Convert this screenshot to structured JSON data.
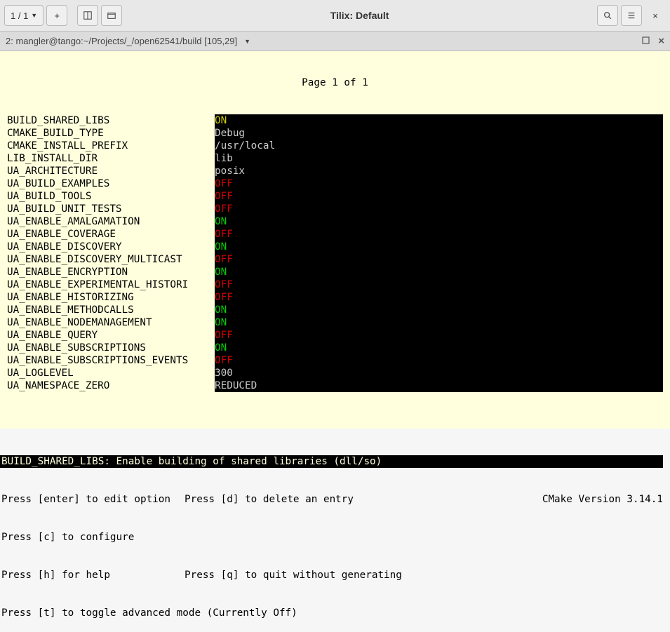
{
  "titlebar": {
    "counter": "1 / 1",
    "title": "Tilix: Default"
  },
  "tab": {
    "label": "2: mangler@tango:~/Projects/_/open62541/build [105,29]"
  },
  "page_header": "Page 1 of 1",
  "options": [
    {
      "key": "BUILD_SHARED_LIBS",
      "val": "ON",
      "cls": "yellow"
    },
    {
      "key": "CMAKE_BUILD_TYPE",
      "val": "Debug",
      "cls": ""
    },
    {
      "key": "CMAKE_INSTALL_PREFIX",
      "val": "/usr/local",
      "cls": ""
    },
    {
      "key": "LIB_INSTALL_DIR",
      "val": "lib",
      "cls": ""
    },
    {
      "key": "UA_ARCHITECTURE",
      "val": "posix",
      "cls": ""
    },
    {
      "key": "UA_BUILD_EXAMPLES",
      "val": "OFF",
      "cls": "red"
    },
    {
      "key": "UA_BUILD_TOOLS",
      "val": "OFF",
      "cls": "red"
    },
    {
      "key": "UA_BUILD_UNIT_TESTS",
      "val": "OFF",
      "cls": "red"
    },
    {
      "key": "UA_ENABLE_AMALGAMATION",
      "val": "ON",
      "cls": "green"
    },
    {
      "key": "UA_ENABLE_COVERAGE",
      "val": "OFF",
      "cls": "red"
    },
    {
      "key": "UA_ENABLE_DISCOVERY",
      "val": "ON",
      "cls": "green"
    },
    {
      "key": "UA_ENABLE_DISCOVERY_MULTICAST",
      "val": "OFF",
      "cls": "red"
    },
    {
      "key": "UA_ENABLE_ENCRYPTION",
      "val": "ON",
      "cls": "green"
    },
    {
      "key": "UA_ENABLE_EXPERIMENTAL_HISTORI",
      "val": "OFF",
      "cls": "red"
    },
    {
      "key": "UA_ENABLE_HISTORIZING",
      "val": "OFF",
      "cls": "red"
    },
    {
      "key": "UA_ENABLE_METHODCALLS",
      "val": "ON",
      "cls": "green"
    },
    {
      "key": "UA_ENABLE_NODEMANAGEMENT",
      "val": "ON",
      "cls": "green"
    },
    {
      "key": "UA_ENABLE_QUERY",
      "val": "OFF",
      "cls": "red"
    },
    {
      "key": "UA_ENABLE_SUBSCRIPTIONS",
      "val": "ON",
      "cls": "green"
    },
    {
      "key": "UA_ENABLE_SUBSCRIPTIONS_EVENTS",
      "val": "OFF",
      "cls": "red"
    },
    {
      "key": "UA_LOGLEVEL",
      "val": "300",
      "cls": ""
    },
    {
      "key": "UA_NAMESPACE_ZERO",
      "val": "REDUCED",
      "cls": ""
    }
  ],
  "status_line": "BUILD_SHARED_LIBS: Enable building of shared libraries (dll/so)",
  "help": {
    "line1_col1": "Press [enter] to edit option",
    "line1_col2": "Press [d] to delete an entry",
    "line1_col3": "CMake Version 3.14.1",
    "line2_col1": "Press [c] to configure",
    "line3_col1": "Press [h] for help",
    "line3_col2": "Press [q] to quit without generating",
    "line4_col1": "Press [t] to toggle advanced mode (Currently Off)"
  }
}
